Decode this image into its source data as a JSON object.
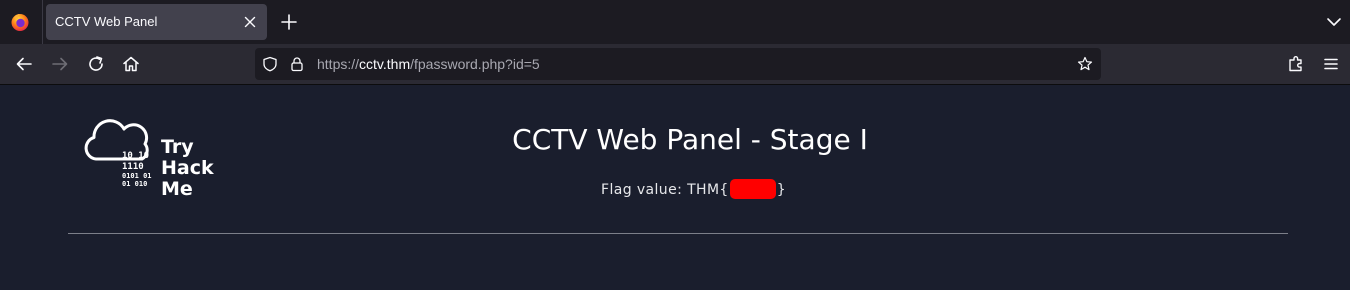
{
  "browser": {
    "tab_title": "CCTV Web Panel",
    "url_prefix": "https://",
    "url_host": "cctv.thm",
    "url_path": "/fpassword.php?id=5",
    "icons": [
      "firefox-icon",
      "close-icon",
      "plus-icon",
      "chevron-down-icon",
      "back-arrow-icon",
      "forward-arrow-icon",
      "reload-icon",
      "home-icon",
      "shield-icon",
      "lock-icon",
      "star-icon",
      "extensions-icon",
      "menu-icon"
    ]
  },
  "page": {
    "logo_text": [
      "Try",
      "Hack",
      "Me"
    ],
    "logo_binary": [
      "10  10",
      "1110",
      "0101  01",
      "01  010"
    ],
    "title": "CCTV Web Panel - Stage I",
    "flag_prefix": "Flag value: THM{",
    "flag_suffix": "}",
    "redaction_color": "#ff0000"
  }
}
